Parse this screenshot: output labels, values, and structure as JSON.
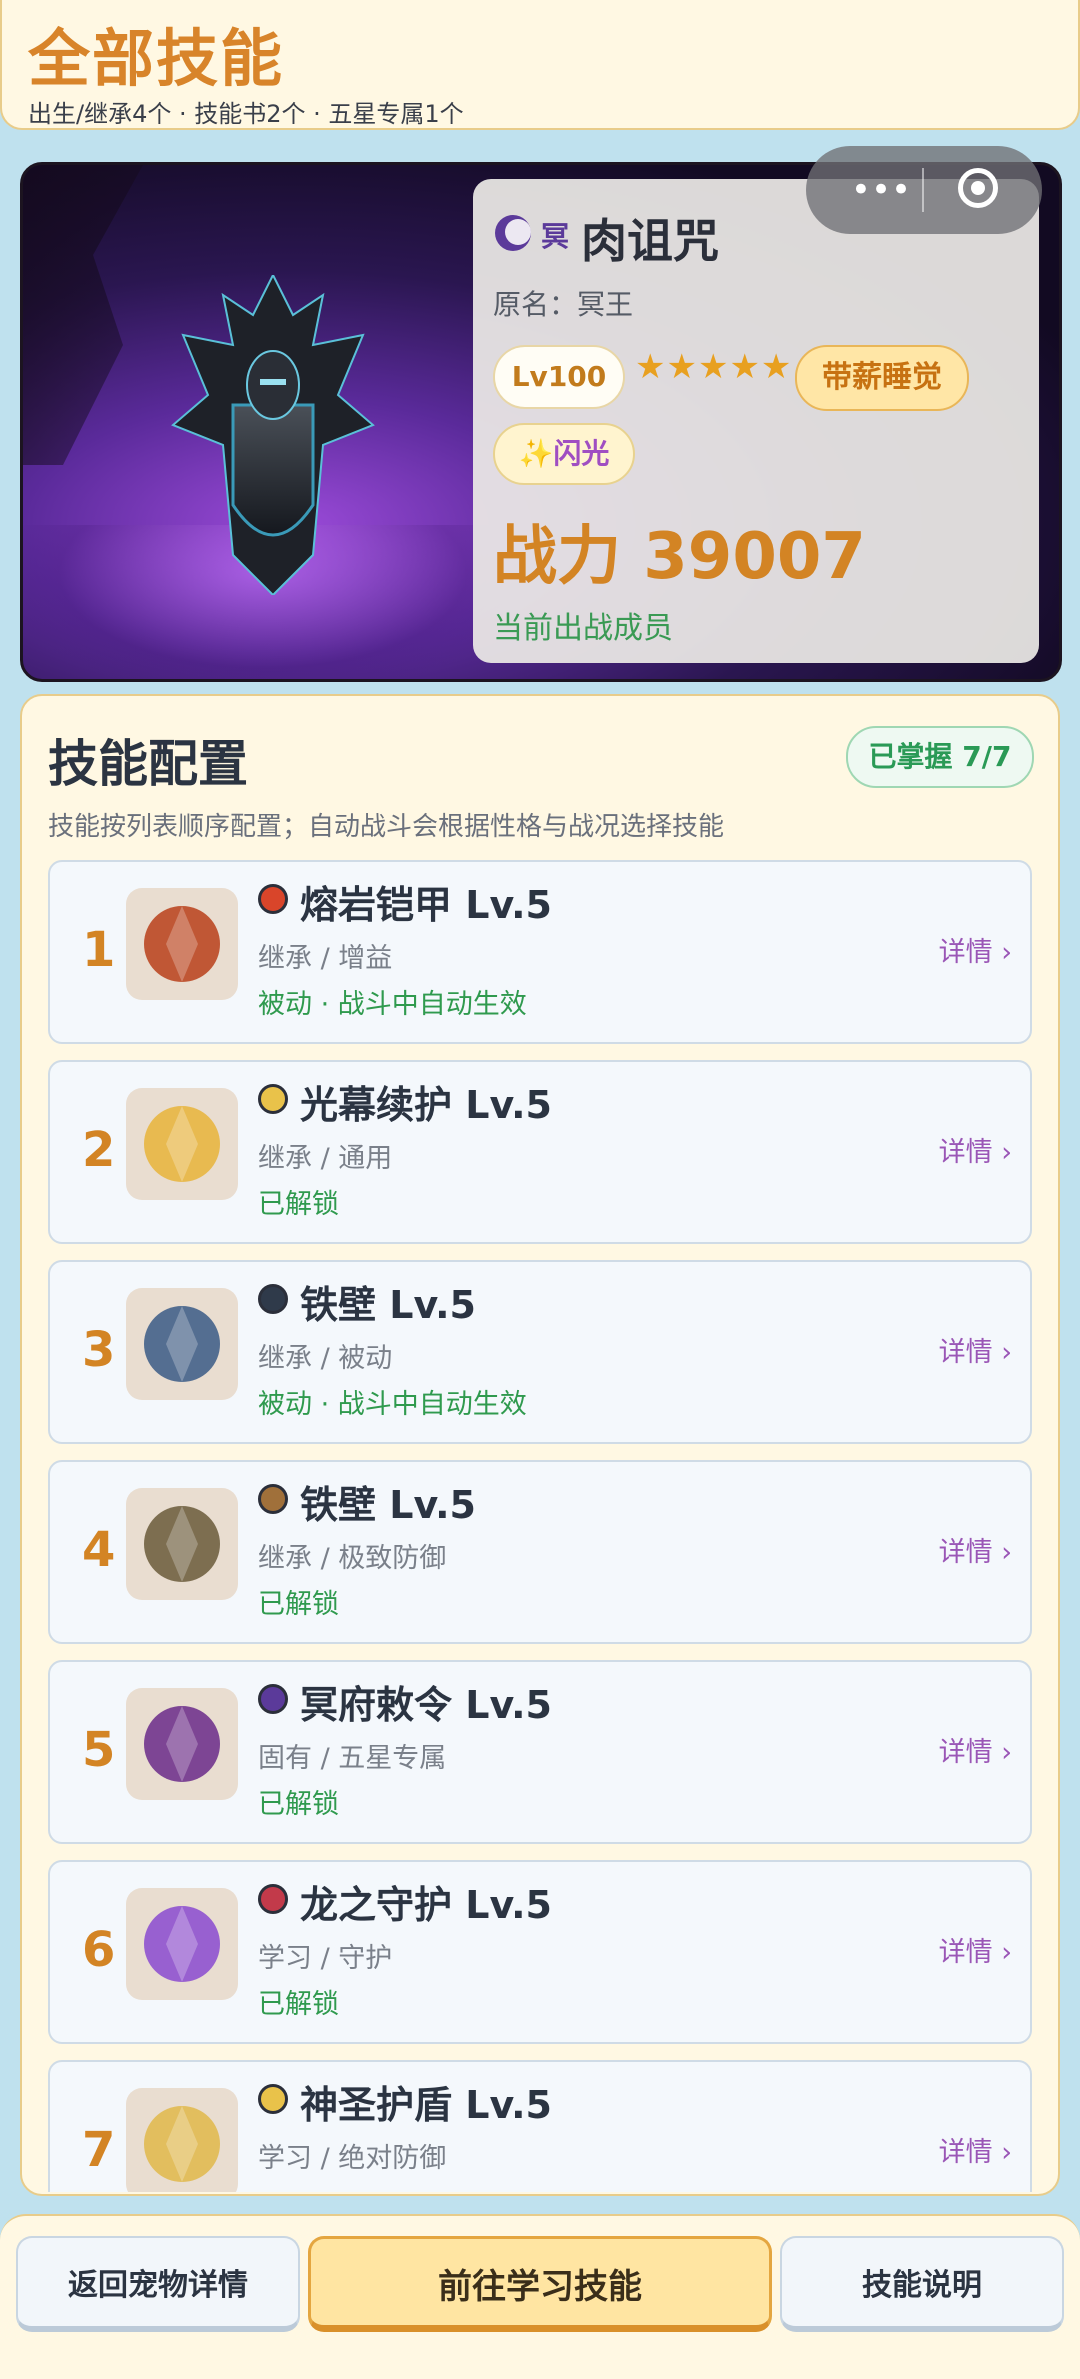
{
  "header": {
    "title": "全部技能",
    "subtitle": "出生/继承4个 · 技能书2个 · 五星专属1个"
  },
  "pet": {
    "element_tag": "冥",
    "name": "肉诅咒",
    "original_name": "原名：冥王",
    "level": "Lv100",
    "stars_text": "★★★★★",
    "stars": 5,
    "trait": "带薪睡觉",
    "shiny_icon": "✨",
    "shiny": "闪光",
    "power": "战力 39007",
    "status": "当前出战成员"
  },
  "capsule": {
    "more": "•••",
    "close_icon": "target-icon"
  },
  "skills_panel": {
    "title": "技能配置",
    "description": "技能按列表顺序配置；自动战斗会根据性格与战况选择技能",
    "mastered": "已掌握 7/7",
    "items": [
      {
        "index": "1",
        "name": "熔岩铠甲  Lv.5",
        "category": "继承 / 增益",
        "status": "被动 · 战斗中自动生效",
        "detail": "详情 ›",
        "element": "fire",
        "badge_color": "#d9452a",
        "art": "#b8401a"
      },
      {
        "index": "2",
        "name": "光幕续护  Lv.5",
        "category": "继承 / 通用",
        "status": "已解锁",
        "detail": "详情 ›",
        "element": "light",
        "badge_color": "#e9c24a",
        "art": "#e8b43a"
      },
      {
        "index": "3",
        "name": "铁壁  Lv.5",
        "category": "继承 / 被动",
        "status": "被动 · 战斗中自动生效",
        "detail": "详情 ›",
        "element": "normal",
        "badge_color": "#2f3a4a",
        "art": "#3a5a86"
      },
      {
        "index": "4",
        "name": "铁壁  Lv.5",
        "category": "继承 / 极致防御",
        "status": "已解锁",
        "detail": "详情 ›",
        "element": "earth",
        "badge_color": "#a0703a",
        "art": "#6a5a3a"
      },
      {
        "index": "5",
        "name": "冥府敕令  Lv.5",
        "category": "固有 / 五星专属",
        "status": "已解锁",
        "detail": "详情 ›",
        "element": "dark",
        "badge_color": "#5b3a9a",
        "art": "#6a2a8a"
      },
      {
        "index": "6",
        "name": "龙之守护  Lv.5",
        "category": "学习 / 守护",
        "status": "已解锁",
        "detail": "详情 ›",
        "element": "dragon",
        "badge_color": "#c23a4a",
        "art": "#8a4ad0"
      },
      {
        "index": "7",
        "name": "神圣护盾  Lv.5",
        "category": "学习 / 绝对防御",
        "status": "",
        "detail": "详情 ›",
        "element": "light",
        "badge_color": "#e9c24a",
        "art": "#e0b84a"
      }
    ]
  },
  "footer": {
    "back": "返回宠物详情",
    "learn": "前往学习技能",
    "help": "技能说明"
  }
}
